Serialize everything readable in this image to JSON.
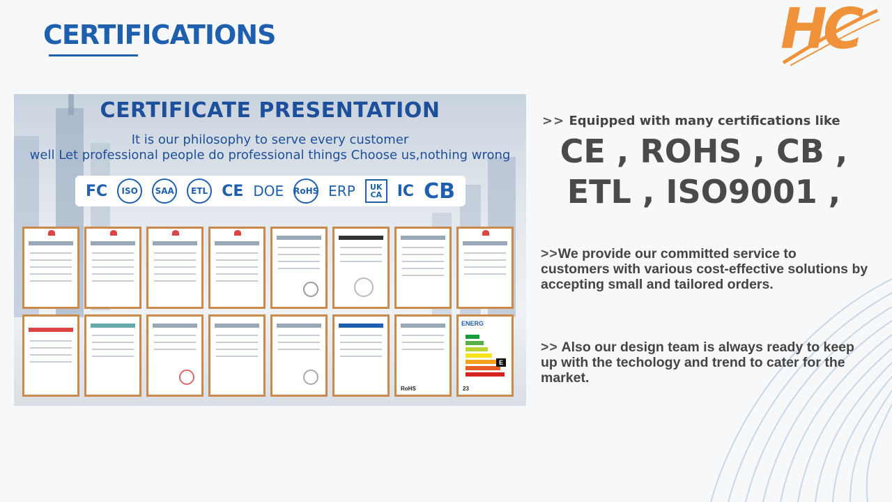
{
  "page": {
    "title": "CERTIFICATIONS",
    "logo_text": "HC",
    "accent_color": "#1e5fae",
    "logo_color": "#f0923a"
  },
  "panel": {
    "heading": "CERTIFICATE PRESENTATION",
    "subline1": "It is our philosophy to serve every customer",
    "subline2": "well Let professional people do professional things Choose us,nothing wrong",
    "logos": [
      "FC",
      "ISO",
      "SAA",
      "ETL",
      "CE",
      "DOE",
      "RoHS",
      "ERP",
      "UK CA",
      "IC",
      "CB"
    ],
    "cert_captions": {
      "rohs": "RoHS",
      "energy_head": "ENERG",
      "energy_class": "E",
      "energy_value": "23"
    }
  },
  "right": {
    "arrow": ">>",
    "intro": "Equipped with many certifications like",
    "certs_line1": "CE , ROHS , CB ,",
    "certs_line2": "ETL , ISO9001 ,",
    "bullet2": "We provide our committed service to customers with various cost-effective solutions by accepting small and tailored orders.",
    "bullet3": "Also our design team is always ready to keep up with the techology and trend to cater for the market."
  }
}
